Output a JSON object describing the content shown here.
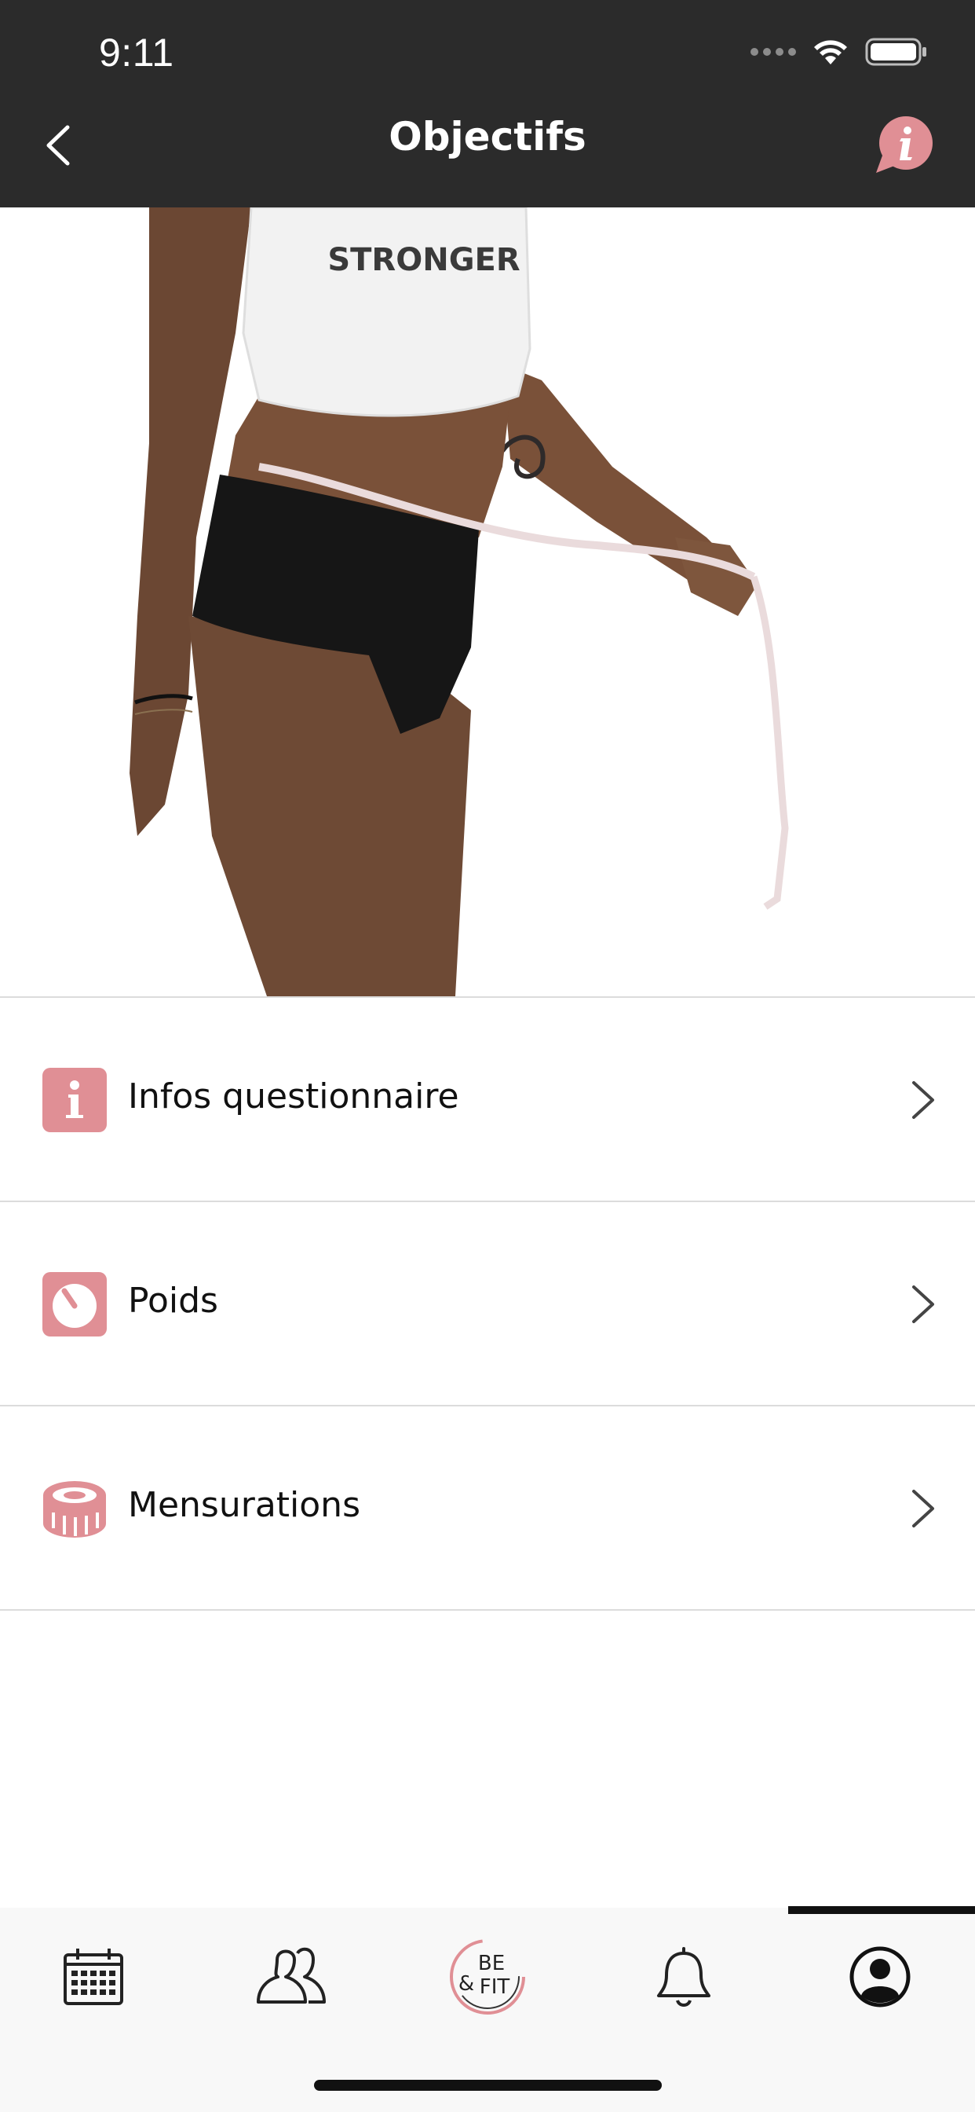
{
  "status_bar": {
    "time": "9:11"
  },
  "header": {
    "title": "Objectifs",
    "back_icon": "chevron-left-icon",
    "info_icon": "info-bubble-icon"
  },
  "hero": {
    "shirt_text": "STRONGER"
  },
  "menu": [
    {
      "label": "Infos questionnaire",
      "icon": "info-icon"
    },
    {
      "label": "Poids",
      "icon": "scale-icon"
    },
    {
      "label": "Mensurations",
      "icon": "tape-measure-icon"
    }
  ],
  "tabbar": {
    "active_index": 4,
    "tabs": [
      {
        "name": "calendar",
        "icon": "calendar-icon"
      },
      {
        "name": "community",
        "icon": "people-icon"
      },
      {
        "name": "home",
        "icon": "befit-logo-icon",
        "logo_top": "BE",
        "logo_amp": "&",
        "logo_bottom": "FIT"
      },
      {
        "name": "notifications",
        "icon": "bell-icon"
      },
      {
        "name": "profile",
        "icon": "profile-icon"
      }
    ]
  },
  "colors": {
    "header_bg": "#2b2b2b",
    "accent": "#e08f95",
    "divider": "#dcdcdc"
  }
}
